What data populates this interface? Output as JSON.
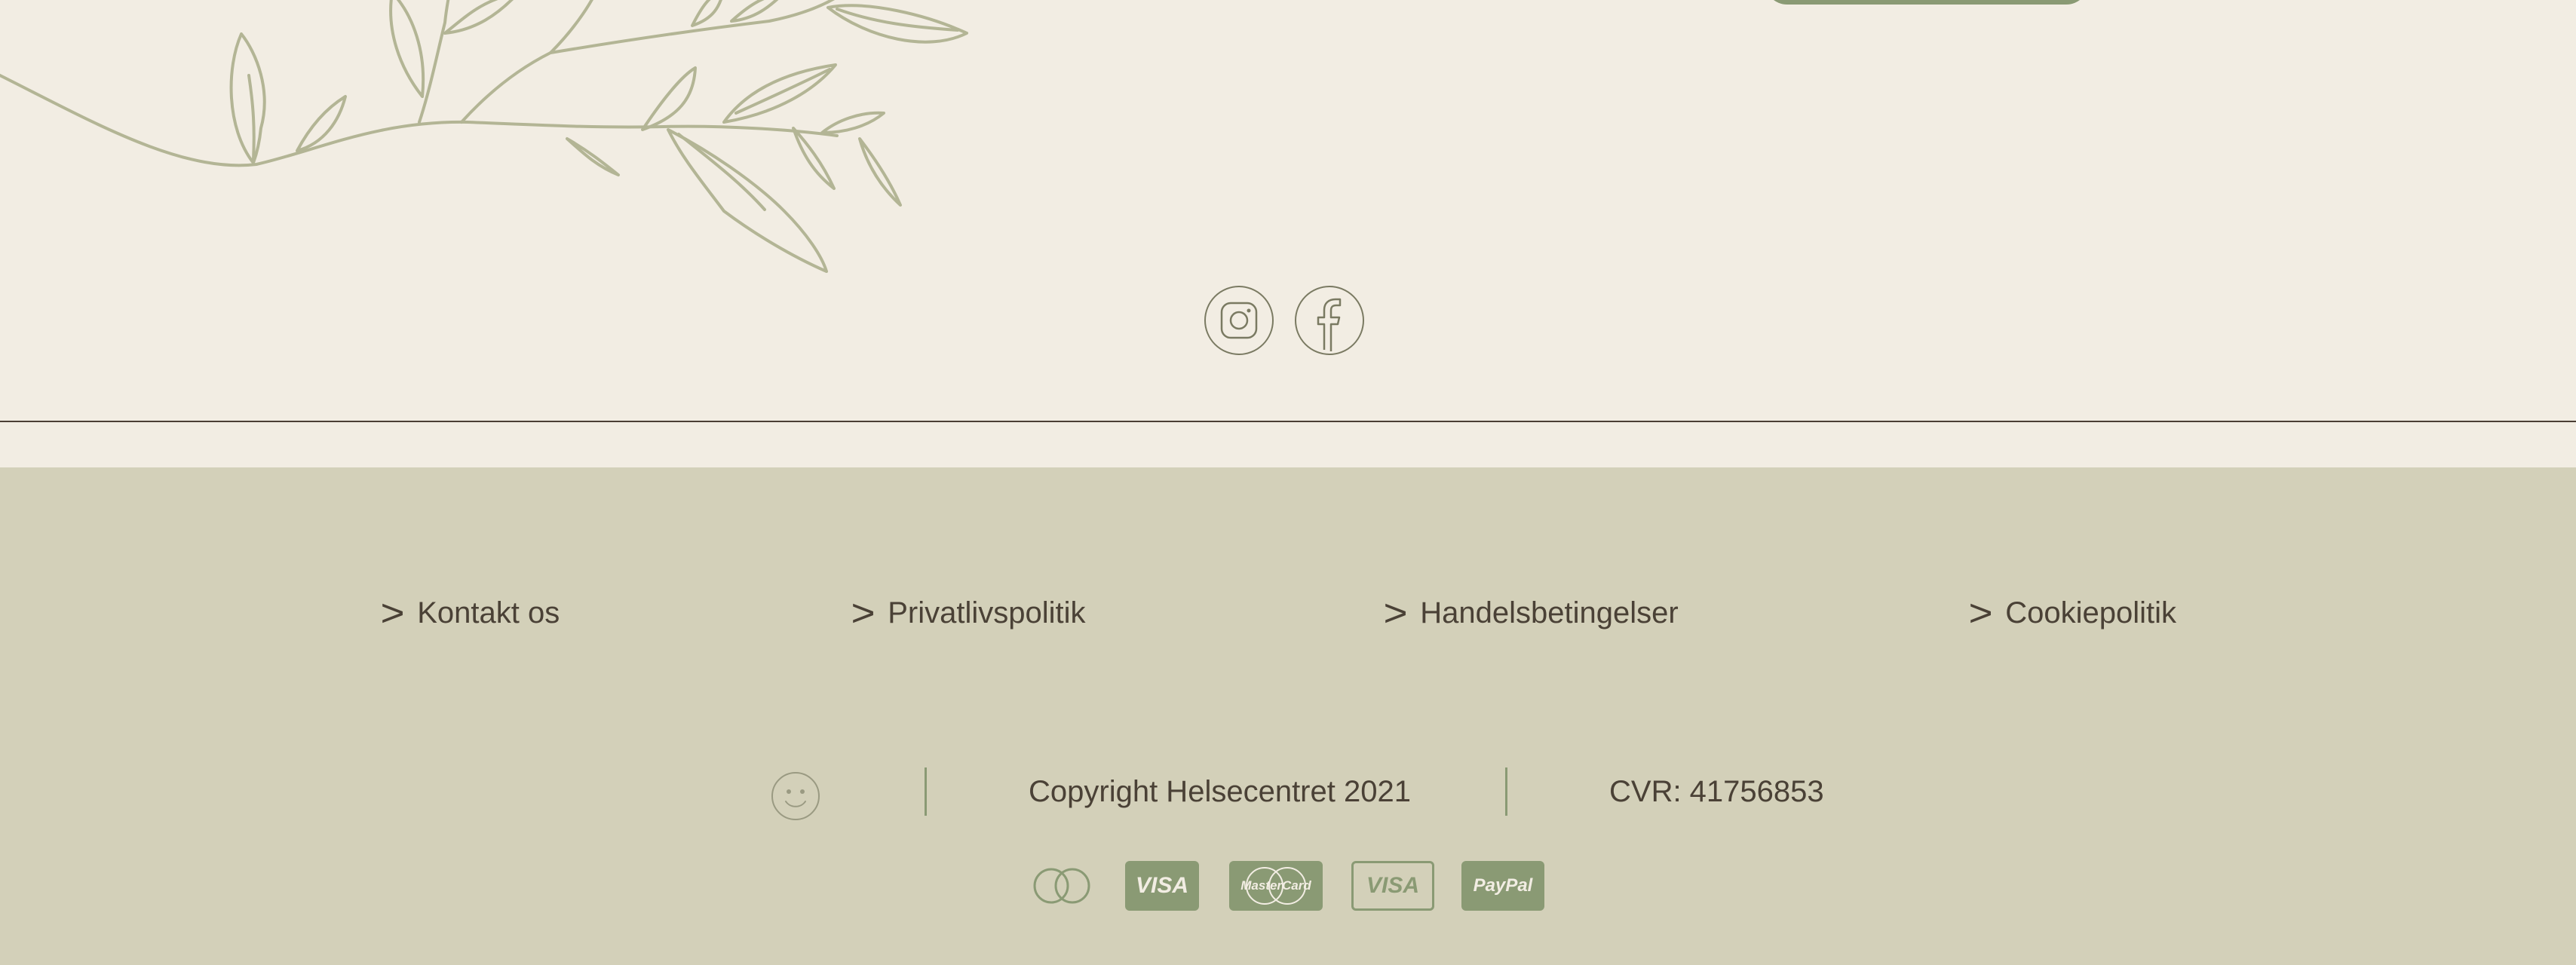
{
  "social": {
    "instagram": "instagram-icon",
    "facebook": "facebook-icon"
  },
  "footer": {
    "links": [
      {
        "label": "Kontakt os"
      },
      {
        "label": "Privatlivspolitik"
      },
      {
        "label": "Handelsbetingelser"
      },
      {
        "label": "Cookiepolitik"
      }
    ],
    "copyright": "Copyright Helsecentret 2021",
    "cvr": "CVR: 41756853",
    "payments": {
      "visa": "VISA",
      "mastercard": "MasterCard",
      "visa_outline": "VISA",
      "paypal": "PayPal"
    }
  },
  "colors": {
    "background": "#f2ede3",
    "footer_background": "#d3d0b9",
    "accent": "#8a9a74",
    "text": "#4a4136",
    "branch": "#b3b595"
  }
}
